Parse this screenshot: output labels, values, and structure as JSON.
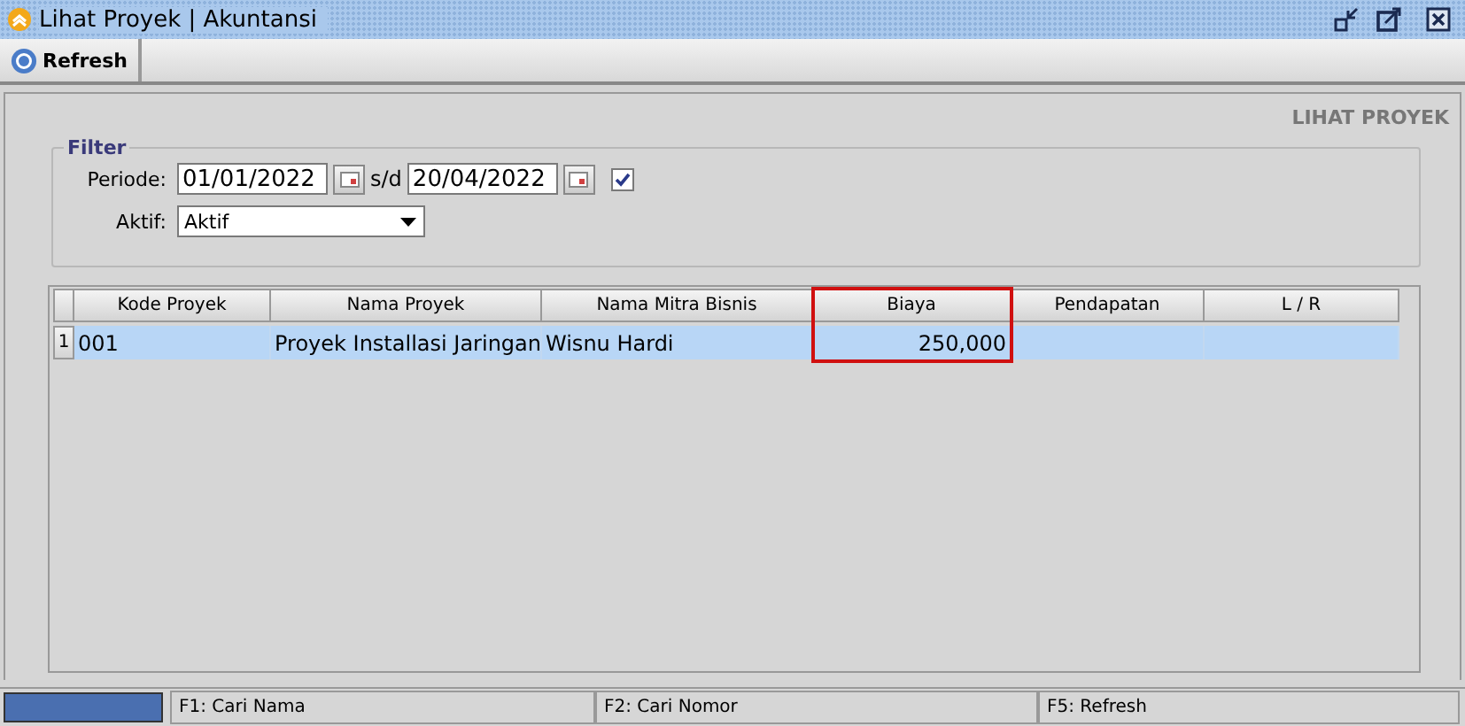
{
  "window": {
    "title": "Lihat Proyek | Akuntansi"
  },
  "toolbar": [
    {
      "label": "Refresh"
    }
  ],
  "page_title": "LIHAT PROYEK",
  "filter": {
    "title": "Filter",
    "periode_label": "Periode:",
    "date_from": "01/01/2022",
    "separator": "s/d",
    "date_to": "20/04/2022",
    "period_checked": true,
    "aktif_label": "Aktif:",
    "aktif_value": "Aktif"
  },
  "table": {
    "columns": [
      {
        "label": "Kode Proyek",
        "highlighted": false
      },
      {
        "label": "Nama Proyek",
        "highlighted": false
      },
      {
        "label": "Nama Mitra Bisnis",
        "highlighted": false
      },
      {
        "label": "Biaya",
        "highlighted": true
      },
      {
        "label": "Pendapatan",
        "highlighted": false
      },
      {
        "label": "L / R",
        "highlighted": false
      }
    ],
    "rows": [
      {
        "number": "1",
        "selected": true,
        "cells": [
          "001",
          "Proyek Installasi Jaringan",
          "Wisnu Hardi",
          "250,000",
          "",
          ""
        ]
      }
    ]
  },
  "status_bar": [
    "F1: Cari Nama",
    "F2: Cari Nomor",
    "F5: Refresh"
  ]
}
